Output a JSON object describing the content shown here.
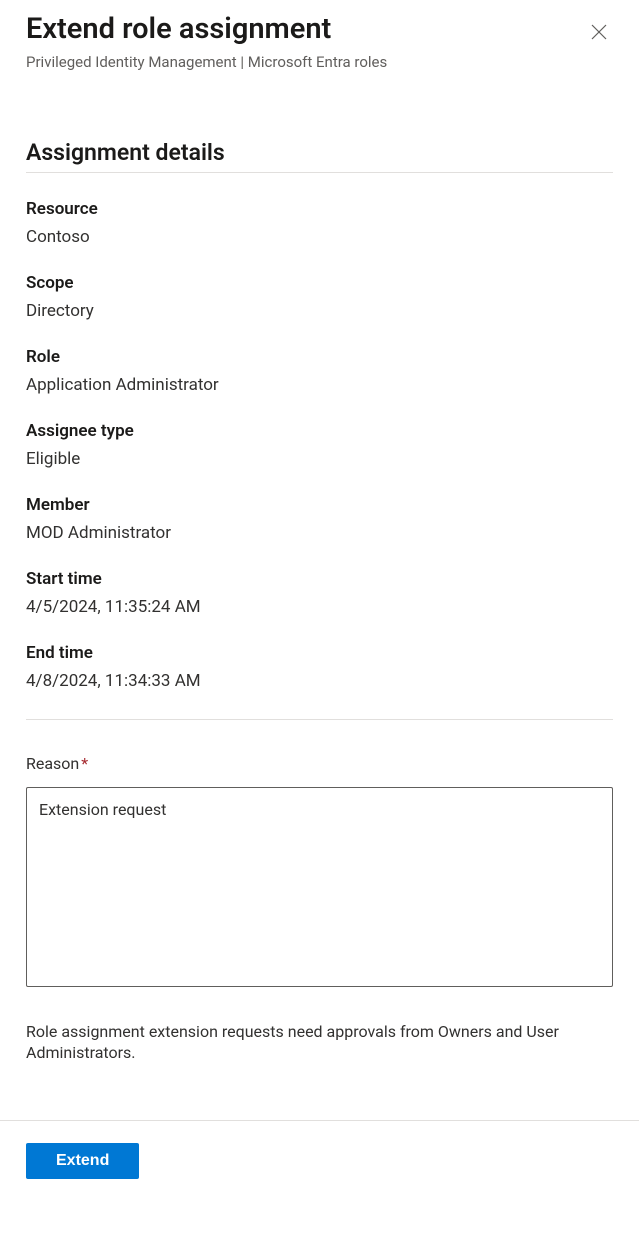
{
  "header": {
    "title": "Extend role assignment",
    "breadcrumb": "Privileged Identity Management | Microsoft Entra roles"
  },
  "section_title": "Assignment details",
  "details": {
    "resource_label": "Resource",
    "resource_value": "Contoso",
    "scope_label": "Scope",
    "scope_value": "Directory",
    "role_label": "Role",
    "role_value": "Application Administrator",
    "assignee_type_label": "Assignee type",
    "assignee_type_value": "Eligible",
    "member_label": "Member",
    "member_value": "MOD Administrator",
    "start_time_label": "Start time",
    "start_time_value": "4/5/2024, 11:35:24 AM",
    "end_time_label": "End time",
    "end_time_value": "4/8/2024, 11:34:33 AM"
  },
  "reason": {
    "label": "Reason",
    "required_marker": "*",
    "value": "Extension request"
  },
  "info_text": "Role assignment extension requests need approvals from Owners and User Administrators.",
  "footer": {
    "extend_label": "Extend"
  }
}
